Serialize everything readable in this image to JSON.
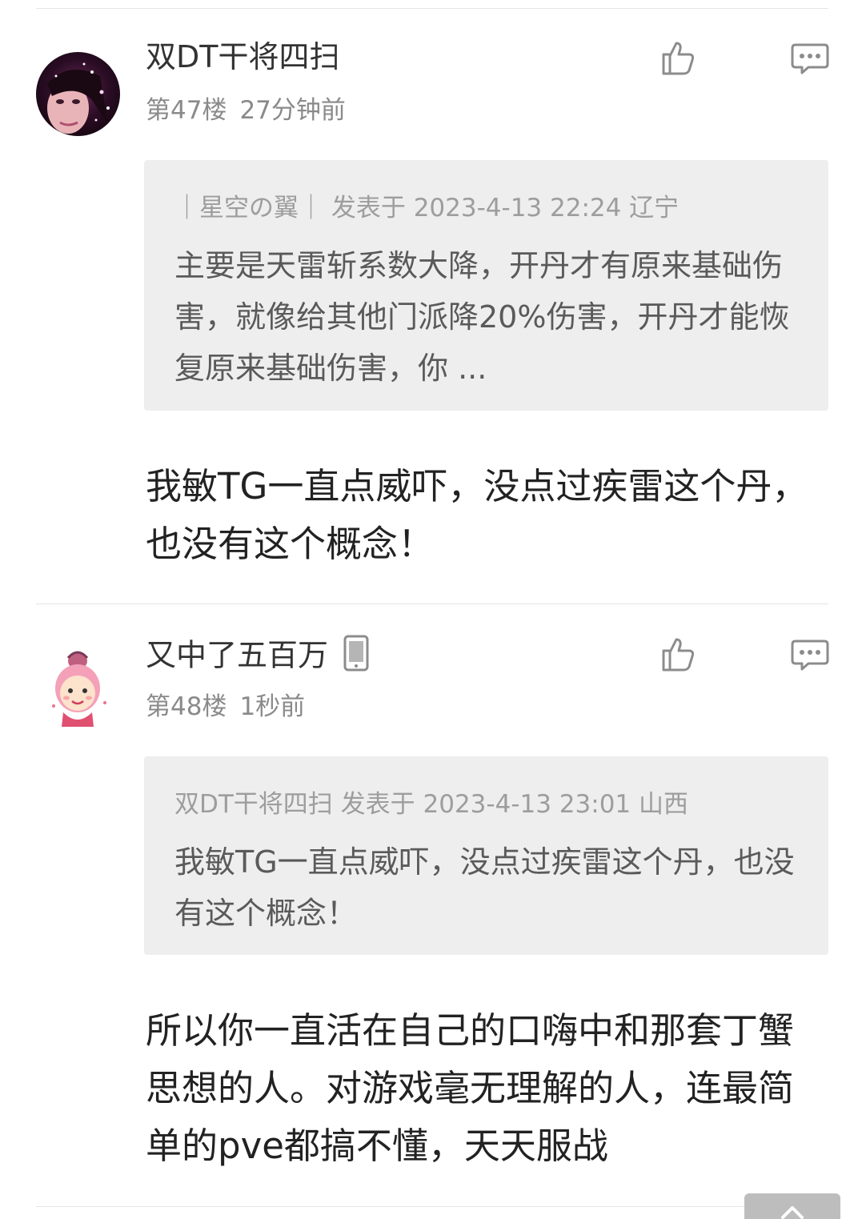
{
  "posts": [
    {
      "username": "双DT干将四扫",
      "floor": "第47楼",
      "time": "27分钟前",
      "avatar_icon": "avatar-girl-sparkle-icon",
      "quote": {
        "header": "｜星空の翼｜ 发表于 2023-4-13 22:24 辽宁",
        "text": "主要是天雷斩系数大降，开丹才有原来基础伤害，就像给其他门派降20%伤害，开丹才能恢复原来基础伤害，你 ..."
      },
      "content": "我敏TG一直点威吓，没点过疾雷这个丹，也没有这个概念！"
    },
    {
      "username": "又中了五百万",
      "floor": "第48楼",
      "time": "1秒前",
      "avatar_icon": "avatar-cartoon-girl-icon",
      "device_icon": "mobile-phone-icon",
      "quote": {
        "header": "双DT干将四扫 发表于 2023-4-13 23:01 山西",
        "text": "我敏TG一直点威吓，没点过疾雷这个丹，也没有这个概念！"
      },
      "content": "所以你一直活在自己的口嗨中和那套丁蟹思想的人。对游戏毫无理解的人，连最简单的pve都搞不懂，天天服战"
    }
  ],
  "icons": {
    "like": "thumbs-up-icon",
    "reply": "comment-bubble-icon",
    "scroll_top": "chevron-up-icon"
  },
  "colors": {
    "quote_bg": "#eeeeee",
    "meta_text": "#8a8a8a",
    "divider": "#e4e4e4"
  }
}
